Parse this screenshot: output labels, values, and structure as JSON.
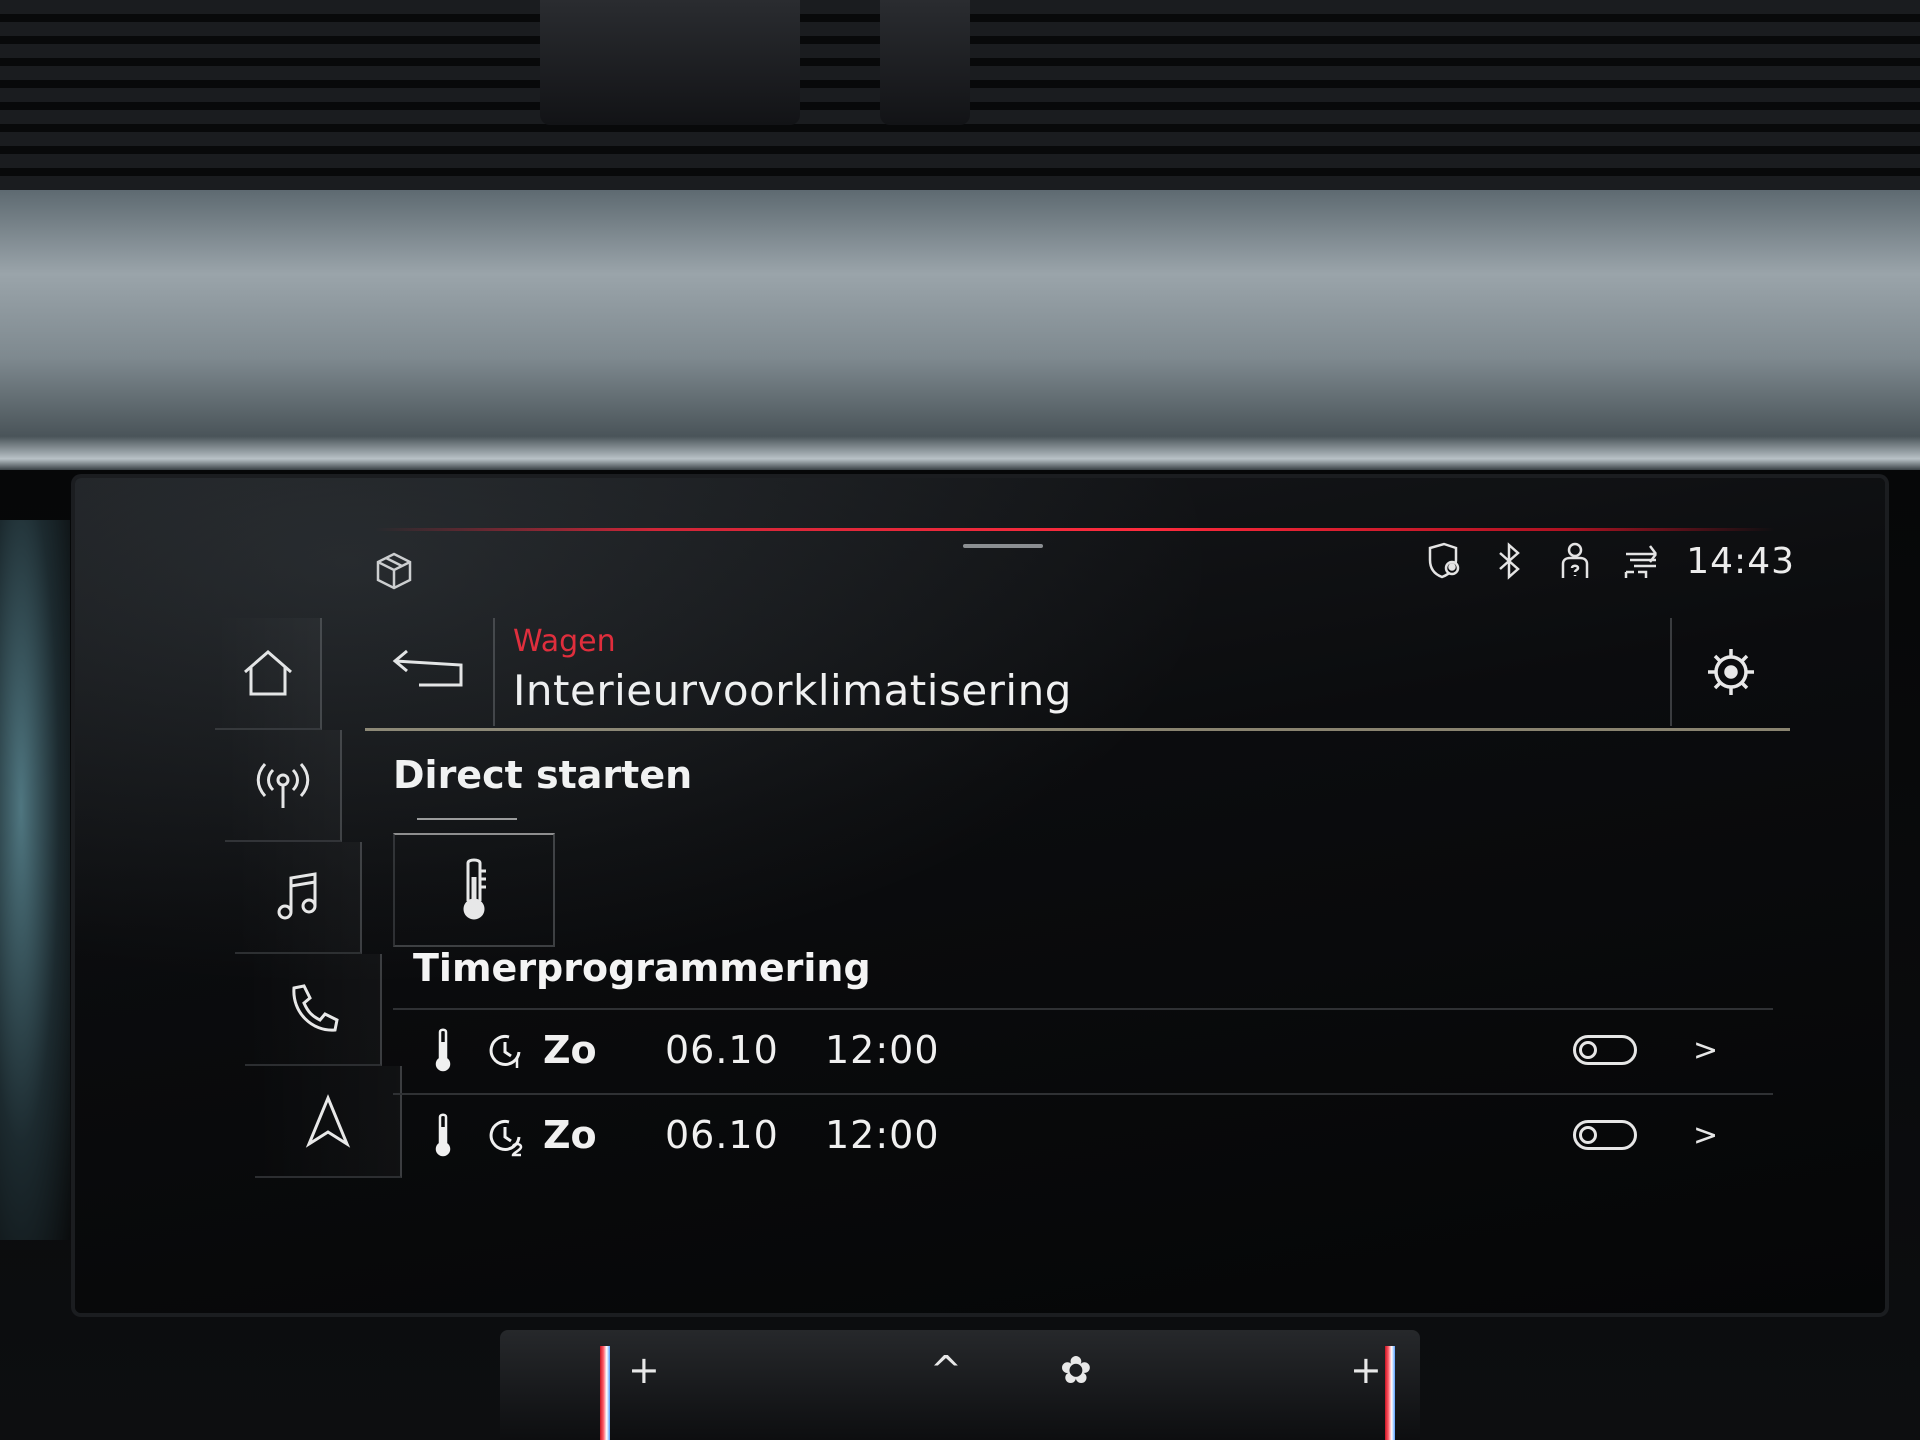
{
  "status_bar": {
    "clock": "14:43",
    "icons": [
      "privacy-location-icon",
      "bluetooth-icon",
      "user-profile-icon",
      "connectivity-icon"
    ]
  },
  "sidebar": {
    "items": [
      {
        "name": "home",
        "icon": "home-icon"
      },
      {
        "name": "radio",
        "icon": "radio-antenna-icon"
      },
      {
        "name": "media",
        "icon": "music-note-icon"
      },
      {
        "name": "phone",
        "icon": "phone-icon"
      },
      {
        "name": "navigation",
        "icon": "navigation-arrow-icon"
      }
    ]
  },
  "header": {
    "breadcrumb": "Wagen",
    "title": "Interieurvoorklimatisering",
    "back_icon": "back-arrow-icon",
    "settings_icon": "gear-icon"
  },
  "direct_start": {
    "title": "Direct starten",
    "tile_icon": "thermometer-icon"
  },
  "timer": {
    "title": "Timerprogrammering",
    "rows": [
      {
        "day": "Zo",
        "date": "06.10",
        "time": "12:00",
        "clock_icon": "timer-1-icon",
        "enabled": false
      },
      {
        "day": "Zo",
        "date": "06.10",
        "time": "12:00",
        "clock_icon": "timer-2-icon",
        "enabled": false
      }
    ]
  },
  "colors": {
    "accent_red": "#e3202f",
    "text": "#f2f2f2",
    "screen_bg": "#0b0c0e"
  }
}
